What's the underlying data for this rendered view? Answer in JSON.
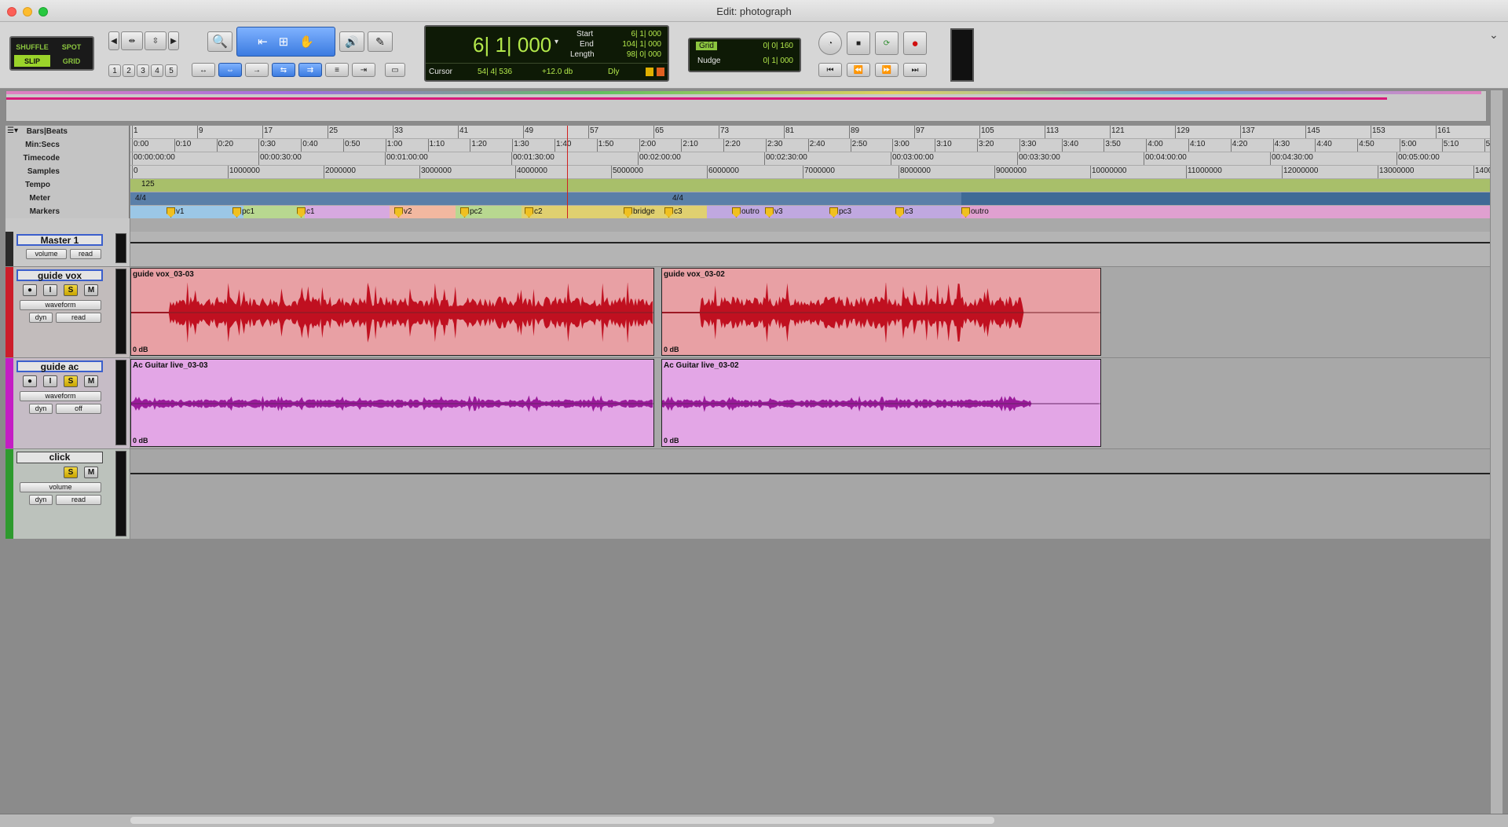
{
  "window": {
    "title": "Edit: photograph"
  },
  "toolbar": {
    "modes": {
      "shuffle": "SHUFFLE",
      "spot": "SPOT",
      "slip": "SLIP",
      "grid": "GRID"
    },
    "zoom_presets": [
      "1",
      "2",
      "3",
      "4",
      "5"
    ],
    "counter": {
      "main": "6| 1| 000",
      "start_label": "Start",
      "start": "6| 1| 000",
      "end_label": "End",
      "end": "104| 1| 000",
      "length_label": "Length",
      "length": "98| 0| 000",
      "cursor_label": "Cursor",
      "cursor": "54| 4| 536",
      "gain": "+12.0 db",
      "dly": "Dly"
    },
    "grid": {
      "label": "Grid",
      "value": "0| 0| 160"
    },
    "nudge": {
      "label": "Nudge",
      "value": "0| 1| 000"
    }
  },
  "rulers": {
    "labels": [
      "Bars|Beats",
      "Min:Secs",
      "Timecode",
      "Samples",
      "Tempo",
      "Meter",
      "Markers"
    ],
    "bars": [
      "1",
      "9",
      "17",
      "25",
      "33",
      "41",
      "49",
      "57",
      "65",
      "73",
      "81",
      "89",
      "97",
      "105",
      "113",
      "121",
      "129",
      "137",
      "145",
      "153",
      "161"
    ],
    "minsecs": [
      "0:00",
      "0:10",
      "0:20",
      "0:30",
      "0:40",
      "0:50",
      "1:00",
      "1:10",
      "1:20",
      "1:30",
      "1:40",
      "1:50",
      "2:00",
      "2:10",
      "2:20",
      "2:30",
      "2:40",
      "2:50",
      "3:00",
      "3:10",
      "3:20",
      "3:30",
      "3:40",
      "3:50",
      "4:00",
      "4:10",
      "4:20",
      "4:30",
      "4:40",
      "4:50",
      "5:00",
      "5:10",
      "5"
    ],
    "timecode": [
      "00:00:00:00",
      "00:00:30:00",
      "00:01:00:00",
      "00:01:30:00",
      "00:02:00:00",
      "00:02:30:00",
      "00:03:00:00",
      "00:03:30:00",
      "00:04:00:00",
      "00:04:30:00",
      "00:05:00:00"
    ],
    "samples": [
      "0",
      "1000000",
      "2000000",
      "3000000",
      "4000000",
      "5000000",
      "6000000",
      "7000000",
      "8000000",
      "9000000",
      "10000000",
      "11000000",
      "12000000",
      "13000000",
      "1400"
    ],
    "tempo": "125",
    "meter": [
      "4/4",
      "4/4"
    ],
    "markers": [
      "v1",
      "pc1",
      "c1",
      "v2",
      "pc2",
      "c2",
      "bridge",
      "c3",
      "outro",
      "v3",
      "pc3",
      "c3",
      "outro"
    ]
  },
  "tracks": [
    {
      "name": "Master 1",
      "view": "volume",
      "auto": "read",
      "color": "#cc2a2a"
    },
    {
      "name": "guide vox",
      "view": "waveform",
      "dyn": "dyn",
      "auto": "read",
      "color": "#cc1e2a",
      "clips": [
        {
          "name": "guide vox_03-03",
          "gain": "0 dB"
        },
        {
          "name": "guide vox_03-02",
          "gain": "0 dB"
        }
      ]
    },
    {
      "name": "guide ac",
      "view": "waveform",
      "dyn": "dyn",
      "auto": "off",
      "color": "#c41ec4",
      "clips": [
        {
          "name": "Ac Guitar live_03-03",
          "gain": "0 dB"
        },
        {
          "name": "Ac Guitar live_03-02",
          "gain": "0 dB"
        }
      ]
    },
    {
      "name": "click",
      "view": "volume",
      "dyn": "dyn",
      "auto": "read",
      "color": "#2e9a2e"
    }
  ],
  "buttons": {
    "rec": "●",
    "input": "I",
    "solo": "S",
    "mute": "M"
  },
  "colors": {
    "vox_clip": "#e8a0a4",
    "vox_wave": "#c01020",
    "ac_clip": "#e3a6e6",
    "ac_wave": "#9a1a9a",
    "lcd_text": "#b3e84b"
  }
}
